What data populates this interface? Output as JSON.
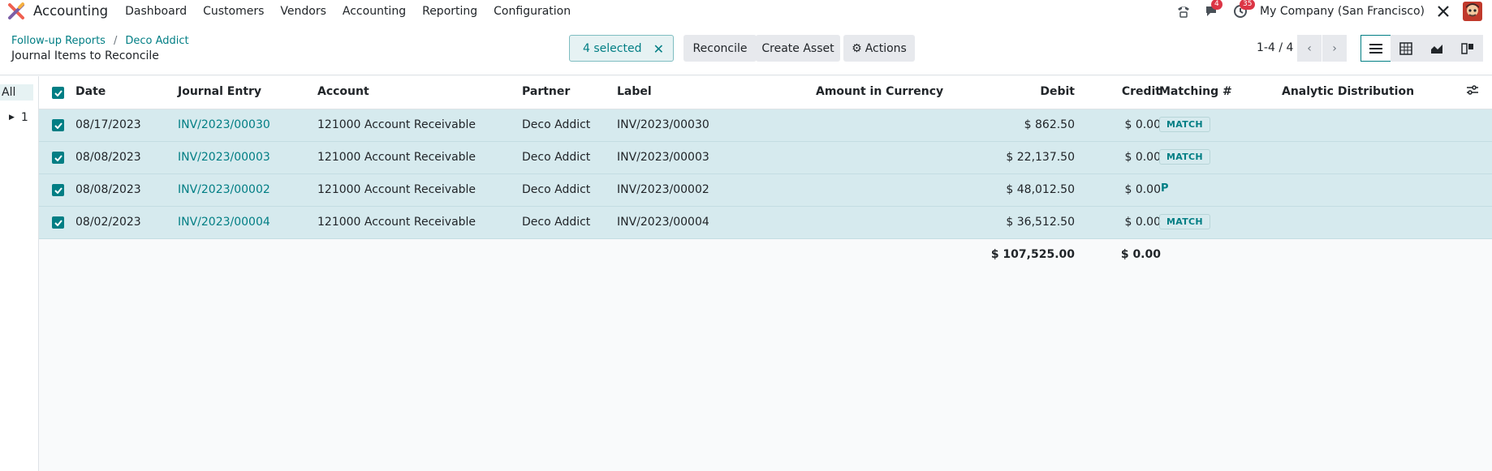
{
  "app": {
    "name": "Accounting"
  },
  "menu": [
    "Dashboard",
    "Customers",
    "Vendors",
    "Accounting",
    "Reporting",
    "Configuration"
  ],
  "nav": {
    "messages_count": "4",
    "activities_count": "35",
    "company": "My Company (San Francisco)"
  },
  "breadcrumb": {
    "parent1": "Follow-up Reports",
    "parent2": "Deco Addict",
    "current": "Journal Items to Reconcile"
  },
  "selection": {
    "label": "4 selected"
  },
  "buttons": {
    "reconcile": "Reconcile",
    "create_asset": "Create Asset",
    "actions": "Actions"
  },
  "pager": {
    "value": "1-4 / 4"
  },
  "sidebar": {
    "all": "All",
    "group": "1"
  },
  "columns": {
    "date": "Date",
    "journal_entry": "Journal Entry",
    "account": "Account",
    "partner": "Partner",
    "label": "Label",
    "amount_currency": "Amount in Currency",
    "debit": "Debit",
    "credit": "Credit",
    "matching": "Matching #",
    "analytic": "Analytic Distribution"
  },
  "rows": [
    {
      "date": "08/17/2023",
      "entry": "INV/2023/00030",
      "account": "121000 Account Receivable",
      "partner": "Deco Addict",
      "label": "INV/2023/00030",
      "debit": "$ 862.50",
      "credit": "$ 0.00",
      "matching": "MATCH"
    },
    {
      "date": "08/08/2023",
      "entry": "INV/2023/00003",
      "account": "121000 Account Receivable",
      "partner": "Deco Addict",
      "label": "INV/2023/00003",
      "debit": "$ 22,137.50",
      "credit": "$ 0.00",
      "matching": "MATCH"
    },
    {
      "date": "08/08/2023",
      "entry": "INV/2023/00002",
      "account": "121000 Account Receivable",
      "partner": "Deco Addict",
      "label": "INV/2023/00002",
      "debit": "$ 48,012.50",
      "credit": "$ 0.00",
      "matching": "P"
    },
    {
      "date": "08/02/2023",
      "entry": "INV/2023/00004",
      "account": "121000 Account Receivable",
      "partner": "Deco Addict",
      "label": "INV/2023/00004",
      "debit": "$ 36,512.50",
      "credit": "$ 0.00",
      "matching": "MATCH"
    }
  ],
  "totals": {
    "debit": "$ 107,525.00",
    "credit": "$ 0.00"
  },
  "colors": {
    "accent": "#017e84",
    "row_selected": "#d6eaee",
    "badge": "#dc3545"
  }
}
